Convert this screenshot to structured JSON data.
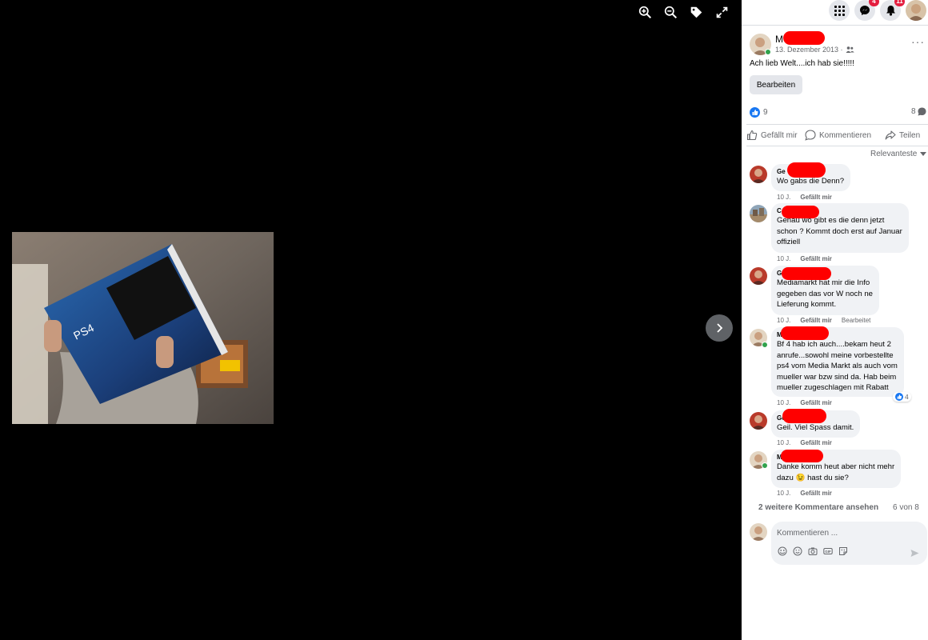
{
  "viewer": {
    "tools": [
      "zoom-in-icon",
      "zoom-out-icon",
      "tag-icon",
      "fullscreen-icon"
    ],
    "next_icon": "chevron-right-icon"
  },
  "topnav": {
    "menu_icon": "grid-menu-icon",
    "messenger_badge": "4",
    "notifications_badge": "11"
  },
  "post": {
    "author_initial": "M",
    "date": "13. Dezember 2013 ·",
    "audience_icon": "friends-icon",
    "text": "Ach lieb Welt....ich hab sie!!!!!",
    "edit_label": "Bearbeiten",
    "like_count": "9",
    "comment_count": "8"
  },
  "actions": {
    "like": "Gefällt mir",
    "comment": "Kommentieren",
    "share": "Teilen"
  },
  "sort_label": "Relevanteste",
  "comments": [
    {
      "name": "Ge",
      "lines": [
        "Wo gabs die Denn?"
      ],
      "time": "10 J.",
      "like": "Gefällt mir",
      "edited": ""
    },
    {
      "name": "C",
      "lines": [
        "Genau wo gibt es die denn jetzt",
        "schon ? Kommt doch erst auf Januar",
        "offiziell"
      ],
      "time": "10 J.",
      "like": "Gefällt mir",
      "edited": ""
    },
    {
      "name": "G",
      "lines": [
        "Mediamarkt hat mir die Info",
        "gegeben das vor W noch ne",
        "Lieferung kommt."
      ],
      "time": "10 J.",
      "like": "Gefällt mir",
      "edited": "Bearbeitet"
    },
    {
      "name": "M",
      "lines": [
        "Bf 4 hab ich auch....bekam heut 2",
        "anrufe...sowohl meine vorbestellte",
        "ps4 vom Media Markt als auch vom",
        "mueller war bzw sind da. Hab beim",
        "mueller zugeschlagen mit Rabatt"
      ],
      "time": "10 J.",
      "like": "Gefällt mir",
      "edited": "",
      "reactions": "4"
    },
    {
      "name": "Ge",
      "lines": [
        "Geil. Viel Spass damit."
      ],
      "time": "10 J.",
      "like": "Gefällt mir",
      "edited": ""
    },
    {
      "name": "M",
      "lines": [
        "Danke komm heut aber nicht mehr",
        "dazu 😉 hast du sie?"
      ],
      "time": "10 J.",
      "like": "Gefällt mir",
      "edited": ""
    }
  ],
  "more_comments": "2 weitere Kommentare ansehen",
  "of_count": "6 von 8",
  "composer": {
    "placeholder": "Kommentieren ...",
    "icons": [
      "avatar-sticker-icon",
      "emoji-icon",
      "camera-icon",
      "gif-icon",
      "sticker-icon"
    ],
    "send_icon": "send-icon"
  },
  "colors": {
    "accent": "#1877f2",
    "redaction": "#ff0000",
    "online": "#31a24c",
    "badge": "#e41e3f"
  }
}
